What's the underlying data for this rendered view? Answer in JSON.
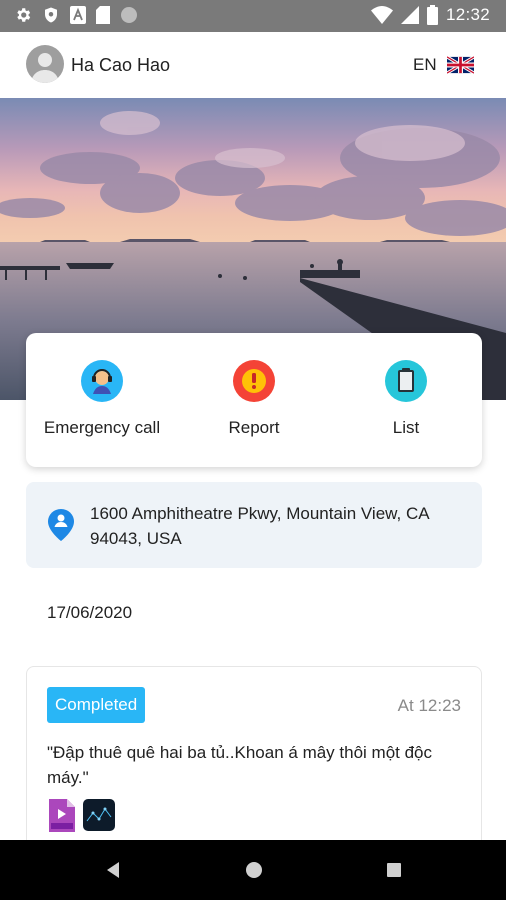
{
  "status_bar": {
    "time": "12:32",
    "icons": [
      "settings-icon",
      "shield-icon",
      "a-icon",
      "sd-card-icon",
      "circle-icon",
      "wifi-icon",
      "signal-icon",
      "battery-icon"
    ]
  },
  "header": {
    "user_name": "Ha Cao Hao",
    "language": "EN",
    "flag": "uk-flag-icon"
  },
  "actions": [
    {
      "label": "Emergency call",
      "icon": "operator-headset-icon",
      "color": "#29b6f6"
    },
    {
      "label": "Report",
      "icon": "alert-icon",
      "color": "#f44336"
    },
    {
      "label": "List",
      "icon": "clipboard-icon",
      "color": "#26c6da"
    }
  ],
  "location": {
    "address": "1600 Amphitheatre Pkwy, Mountain View, CA 94043, USA"
  },
  "date": "17/06/2020",
  "report": {
    "status": "Completed",
    "time": "At 12:23",
    "text": "\"Đập thuê quê hai ba tủ..Khoan á mây thôi một độc máy.\"",
    "attachments": [
      "mp4-file-icon",
      "image-thumbnail"
    ]
  },
  "colors": {
    "accent": "#29b6f6",
    "status_bar": "#7a7a7a",
    "address_bg": "#eef3f8"
  }
}
